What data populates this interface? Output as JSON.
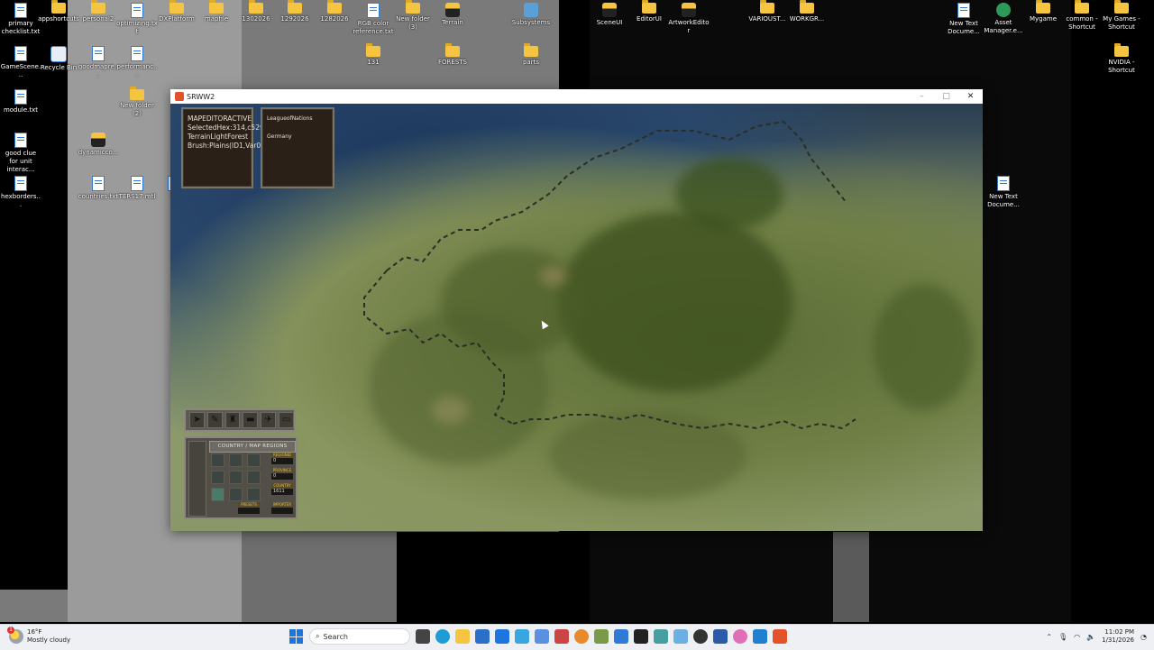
{
  "desktop_icons": [
    {
      "id": "i1",
      "label": "primary checklist.txt",
      "type": "doc"
    },
    {
      "id": "i2",
      "label": "appshortcuts",
      "type": "folder"
    },
    {
      "id": "i3",
      "label": "personal2",
      "type": "folder"
    },
    {
      "id": "i4",
      "label": "optimizing.txt",
      "type": "doc"
    },
    {
      "id": "i5",
      "label": "DXPlatform",
      "type": "folder"
    },
    {
      "id": "i6",
      "label": "mapfile",
      "type": "folder"
    },
    {
      "id": "i7",
      "label": "1302026",
      "type": "folder"
    },
    {
      "id": "i8",
      "label": "1292026",
      "type": "folder"
    },
    {
      "id": "i9",
      "label": "1282026",
      "type": "folder"
    },
    {
      "id": "i10",
      "label": "RGB color reference.txt",
      "type": "doc"
    },
    {
      "id": "i11",
      "label": "New folder (3)",
      "type": "folder"
    },
    {
      "id": "i12",
      "label": "Terrain",
      "type": "film"
    },
    {
      "id": "i13",
      "label": "Subsystems",
      "type": "image"
    },
    {
      "id": "i14",
      "label": "GameScene...",
      "type": "doc"
    },
    {
      "id": "i15",
      "label": "Recycle Bin",
      "type": "recycle"
    },
    {
      "id": "i16",
      "label": "goodmapre...",
      "type": "doc"
    },
    {
      "id": "i17",
      "label": "performanc...",
      "type": "doc"
    },
    {
      "id": "i18",
      "label": "131",
      "type": "folder"
    },
    {
      "id": "i19",
      "label": "FORESTS",
      "type": "folder"
    },
    {
      "id": "i20",
      "label": "parts",
      "type": "folder"
    },
    {
      "id": "i21",
      "label": "module.txt",
      "type": "doc"
    },
    {
      "id": "i22",
      "label": "New folder (2)",
      "type": "folder"
    },
    {
      "id": "i23",
      "label": "good clue for unit interac...",
      "type": "doc"
    },
    {
      "id": "i24",
      "label": "dynamicco...",
      "type": "film"
    },
    {
      "id": "i25",
      "label": "hexborders...",
      "type": "doc"
    },
    {
      "id": "i26",
      "label": "countries.txt",
      "type": "doc"
    },
    {
      "id": "i27",
      "label": "TERS17.mtl",
      "type": "doc"
    },
    {
      "id": "i28",
      "label": "TE",
      "type": "doc"
    },
    {
      "id": "i29",
      "label": "SceneUI",
      "type": "film"
    },
    {
      "id": "i30",
      "label": "EditorUI",
      "type": "folder"
    },
    {
      "id": "i31",
      "label": "ArtworkEditor",
      "type": "film"
    },
    {
      "id": "i32",
      "label": "VARIOUST...",
      "type": "folder"
    },
    {
      "id": "i33",
      "label": "WORKGR...",
      "type": "folder"
    },
    {
      "id": "i34",
      "label": "New Text Docume...",
      "type": "doc"
    },
    {
      "id": "i35",
      "label": "Asset Manager.e...",
      "type": "app"
    },
    {
      "id": "i36",
      "label": "Mygame",
      "type": "folder"
    },
    {
      "id": "i37",
      "label": "common - Shortcut",
      "type": "folder"
    },
    {
      "id": "i38",
      "label": "My Games - Shortcut",
      "type": "folder"
    },
    {
      "id": "i39",
      "label": "NVIDIA - Shortcut",
      "type": "folder"
    },
    {
      "id": "i40",
      "label": "New Text Docume...",
      "type": "doc"
    }
  ],
  "window": {
    "title": "SRWW2",
    "minimize": "–",
    "maximize": "□",
    "close": "✕"
  },
  "info_panel": {
    "lines": [
      "MAPEDITORACTIVE",
      "SelectedHex:314,c529",
      "TerrainLightForest",
      "Brush:Plains(ID1,Var0)"
    ]
  },
  "nation_panel": {
    "lines": [
      "LeagueofNations",
      "",
      "Germany"
    ]
  },
  "editor_panel": {
    "tab_label": "COUNTRY / MAP REGIONS",
    "fields": [
      {
        "label": "REGIONID",
        "value": "0"
      },
      {
        "label": "PROVINCE",
        "value": "0"
      },
      {
        "label": "COUNTRY",
        "value": "1611"
      },
      {
        "label": "PRESETS",
        "value": ""
      },
      {
        "label": "IMPORTER",
        "value": ""
      }
    ]
  },
  "taskbar": {
    "weather_temp": "16°F",
    "weather_desc": "Mostly cloudy",
    "weather_badge": "1",
    "search_placeholder": "Search",
    "time": "11:02 PM",
    "date": "1/31/2026"
  },
  "colors": {
    "folder": "#f5c542",
    "accent": "#1d76e0",
    "title_logo": "#e2522b"
  }
}
